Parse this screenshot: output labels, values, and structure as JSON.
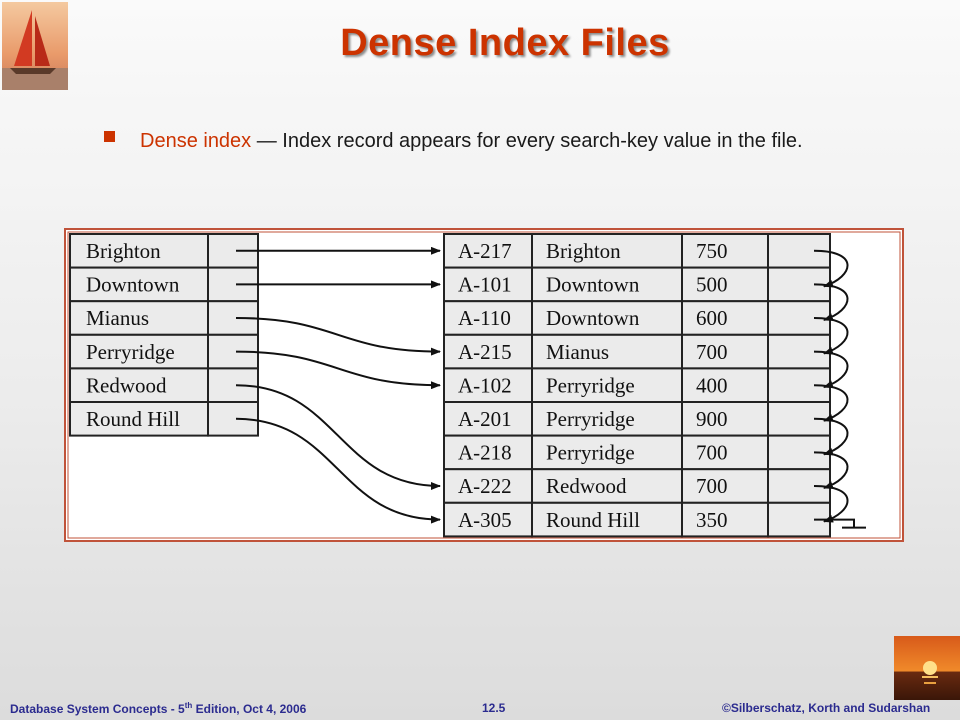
{
  "title": "Dense Index Files",
  "bullet": {
    "term": "Dense index",
    "text": " — Index record appears for every search-key value in the file."
  },
  "index_entries": [
    "Brighton",
    "Downtown",
    "Mianus",
    "Perryridge",
    "Redwood",
    "Round Hill"
  ],
  "records": [
    {
      "account": "A-217",
      "branch": "Brighton",
      "balance": "750"
    },
    {
      "account": "A-101",
      "branch": "Downtown",
      "balance": "500"
    },
    {
      "account": "A-110",
      "branch": "Downtown",
      "balance": "600"
    },
    {
      "account": "A-215",
      "branch": "Mianus",
      "balance": "700"
    },
    {
      "account": "A-102",
      "branch": "Perryridge",
      "balance": "400"
    },
    {
      "account": "A-201",
      "branch": "Perryridge",
      "balance": "900"
    },
    {
      "account": "A-218",
      "branch": "Perryridge",
      "balance": "700"
    },
    {
      "account": "A-222",
      "branch": "Redwood",
      "balance": "700"
    },
    {
      "account": "A-305",
      "branch": "Round Hill",
      "balance": "350"
    }
  ],
  "index_pointers": [
    0,
    1,
    3,
    4,
    7,
    8
  ],
  "footer": {
    "left_pre": "Database  System Concepts  - 5",
    "left_sup": "th",
    "left_post": " Edition, Oct 4, 2006",
    "center": "12.5",
    "right": "©Silberschatz, Korth and Sudarshan"
  },
  "colors": {
    "accent": "#cc3300",
    "footer": "#2b2b8f",
    "frame": "#c0533a"
  }
}
